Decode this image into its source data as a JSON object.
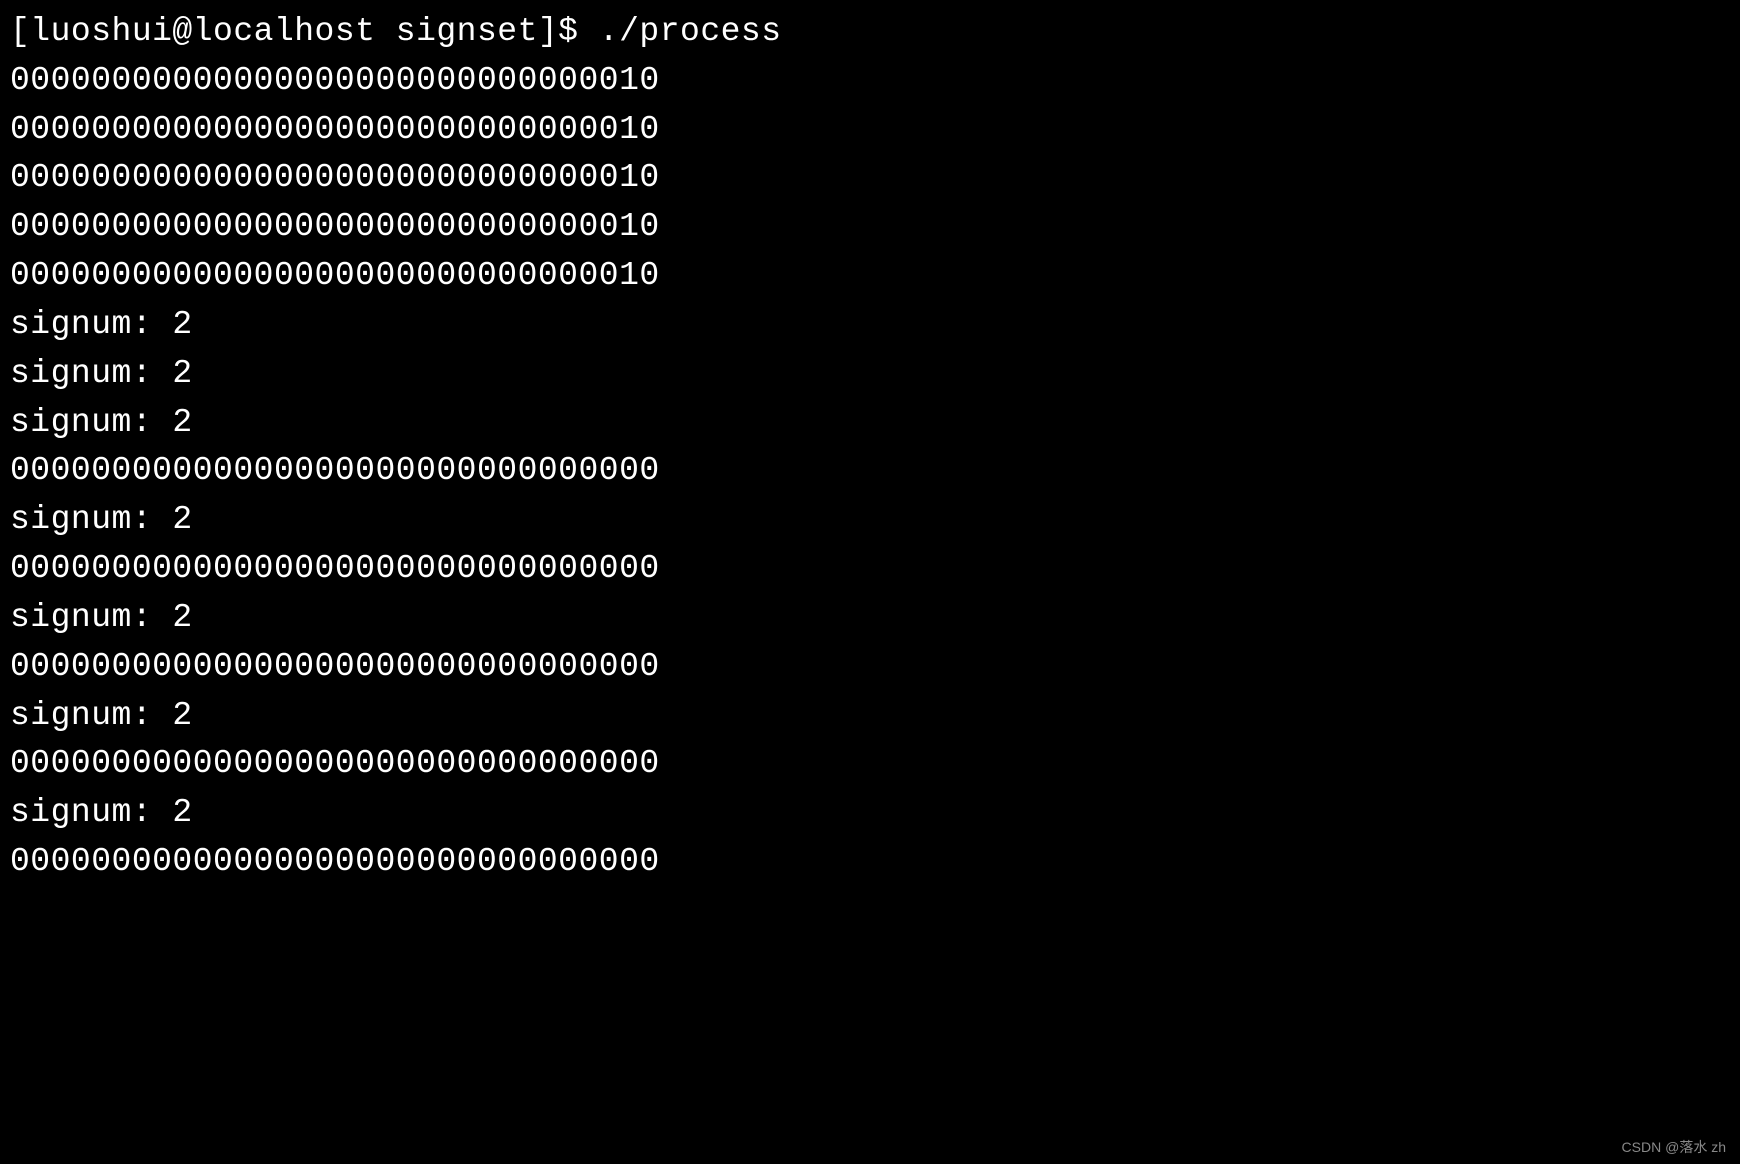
{
  "terminal": {
    "prompt": "[luoshui@localhost signset]$ ",
    "command": "./process",
    "output": [
      "00000000000000000000000000000010",
      "00000000000000000000000000000010",
      "00000000000000000000000000000010",
      "00000000000000000000000000000010",
      "00000000000000000000000000000010",
      "signum: 2",
      "signum: 2",
      "signum: 2",
      "00000000000000000000000000000000",
      "signum: 2",
      "00000000000000000000000000000000",
      "signum: 2",
      "00000000000000000000000000000000",
      "signum: 2",
      "00000000000000000000000000000000",
      "signum: 2",
      "00000000000000000000000000000000"
    ]
  },
  "watermark": "CSDN @落水 zh"
}
